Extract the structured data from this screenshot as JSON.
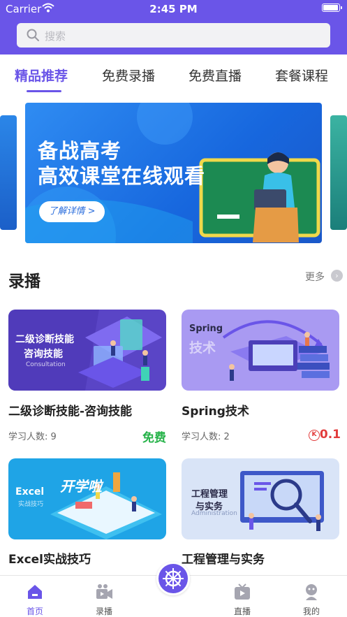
{
  "status_bar": {
    "carrier": "Carrier",
    "time": "2:45 PM",
    "battery_level": 1.0
  },
  "search": {
    "placeholder": "搜索"
  },
  "tabs": [
    {
      "label": "精品推荐",
      "active": true
    },
    {
      "label": "免费录播",
      "active": false
    },
    {
      "label": "免费直播",
      "active": false
    },
    {
      "label": "套餐课程",
      "active": false
    }
  ],
  "banner": {
    "line1": "备战高考",
    "line2": "高效课堂在线观看",
    "button": "了解详情 >"
  },
  "section": {
    "title": "录播",
    "more": "更多"
  },
  "courses": [
    {
      "title": "二级诊断技能-咨询技能",
      "students": "学习人数: 9",
      "price": "免费",
      "is_free": true,
      "image_text": "二级诊断技能",
      "image_text2": "咨询技能",
      "image_sub": "Consultation",
      "image_color": "#5a45c6"
    },
    {
      "title": "Spring技术",
      "students": "学习人数: 2",
      "price": "0.1",
      "is_free": false,
      "image_text": "Spring",
      "image_text2": "技术",
      "image_color": "#a99af2"
    },
    {
      "title": "Excel实战技巧",
      "students": "",
      "price": "",
      "is_free": true,
      "image_text": "Excel",
      "image_text2": "实战技巧",
      "image_text3": "开学啦",
      "image_color": "#1fa4e6"
    },
    {
      "title": "工程管理与实务",
      "students": "",
      "price": "",
      "is_free": true,
      "image_text": "工程管理",
      "image_text2": "与实务",
      "image_sub": "Administration",
      "image_color": "#d9e4f7"
    }
  ],
  "bottom_nav": [
    {
      "label": "首页",
      "icon": "home-icon",
      "active": true
    },
    {
      "label": "录播",
      "icon": "video-camera-icon",
      "active": false
    },
    {
      "label": "",
      "icon": "helm-wheel-icon",
      "active": false
    },
    {
      "label": "直播",
      "icon": "tv-play-icon",
      "active": false
    },
    {
      "label": "我的",
      "icon": "user-avatar-icon",
      "active": false
    }
  ],
  "colors": {
    "brand": "#6a55e8",
    "free": "#27b34a",
    "price": "#e23b3b"
  }
}
